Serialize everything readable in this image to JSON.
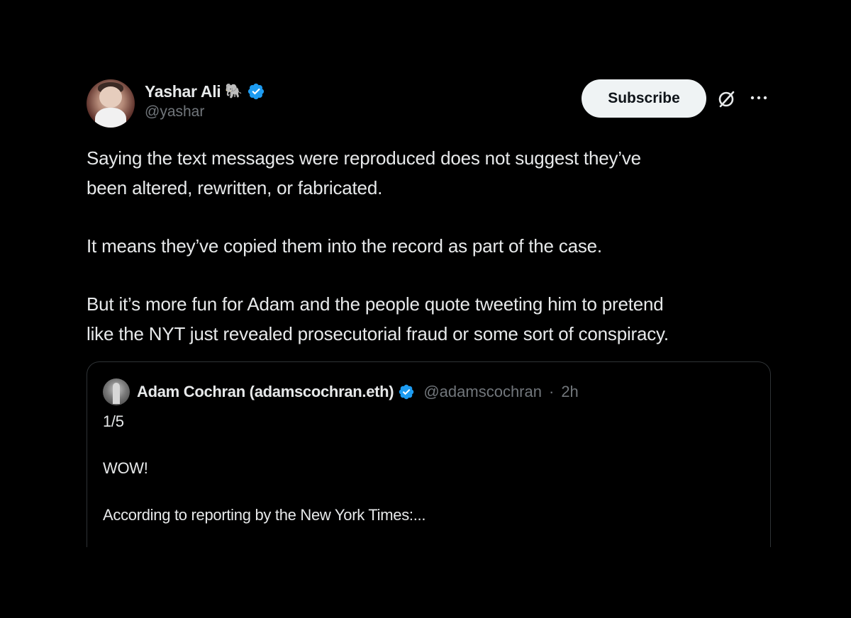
{
  "author": {
    "display_name": "Yashar Ali",
    "emoji": "🐘",
    "handle": "@yashar"
  },
  "actions": {
    "subscribe_label": "Subscribe"
  },
  "tweet": {
    "paragraphs": [
      "Saying the text messages were reproduced does not suggest they’ve\nbeen altered, rewritten, or fabricated.",
      "It means they’ve copied them into the record as part of the case.",
      "But it’s more fun for Adam and the people quote tweeting him to pretend\nlike the NYT just revealed prosecutorial fraud or some sort of conspiracy."
    ]
  },
  "quoted_tweet": {
    "display_name": "Adam Cochran (adamscochran.eth)",
    "handle": "@adamscochran",
    "separator": "·",
    "time": "2h",
    "paragraphs": [
      "1/5",
      "WOW!",
      "According to reporting by the New York Times:..."
    ]
  },
  "colors": {
    "background": "#000000",
    "text": "#e7e9ea",
    "muted": "#71767b",
    "verified": "#1d9bf0",
    "border": "#2f3336",
    "button_bg": "#eff3f4"
  },
  "icons": [
    "verified-badge-icon",
    "elephant-emoji-icon",
    "grok-icon",
    "more-options-icon"
  ]
}
